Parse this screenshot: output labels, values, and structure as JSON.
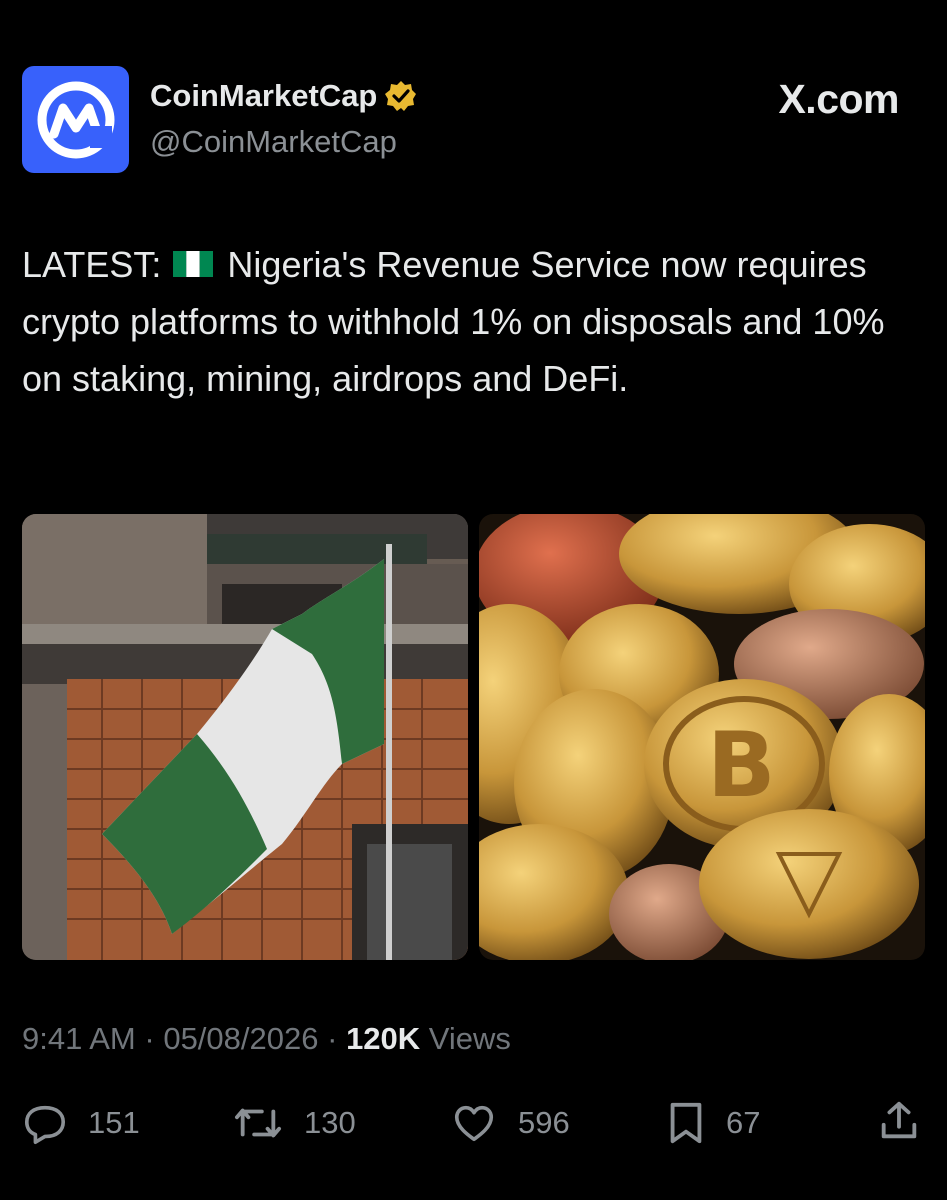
{
  "account": {
    "display_name": "CoinMarketCap",
    "handle": "@CoinMarketCap",
    "verified_icon": "verified-badge-icon",
    "avatar_icon": "coinmarketcap-logo-icon"
  },
  "brand": {
    "label": "X.com"
  },
  "tweet": {
    "prefix": "LATEST:",
    "flag_icon": "nigeria-flag-icon",
    "body": "Nigeria's Revenue Service now requires crypto platforms to withhold 1% on disposals and 10% on staking, mining, airdrops and DeFi."
  },
  "media": [
    {
      "icon": "nigeria-flag-building-photo"
    },
    {
      "icon": "crypto-coins-photo"
    }
  ],
  "meta": {
    "time": "9:41 AM",
    "separator": "·",
    "date": "05/08/2026",
    "views_count": "120K",
    "views_label": "Views"
  },
  "actions": {
    "reply_count": "151",
    "retweet_count": "130",
    "like_count": "596",
    "bookmark_count": "67"
  },
  "colors": {
    "background": "#000000",
    "text": "#e7e9ea",
    "muted": "#71767b",
    "avatar_bg": "#3861fb",
    "verified_gold": "#e8b931"
  }
}
